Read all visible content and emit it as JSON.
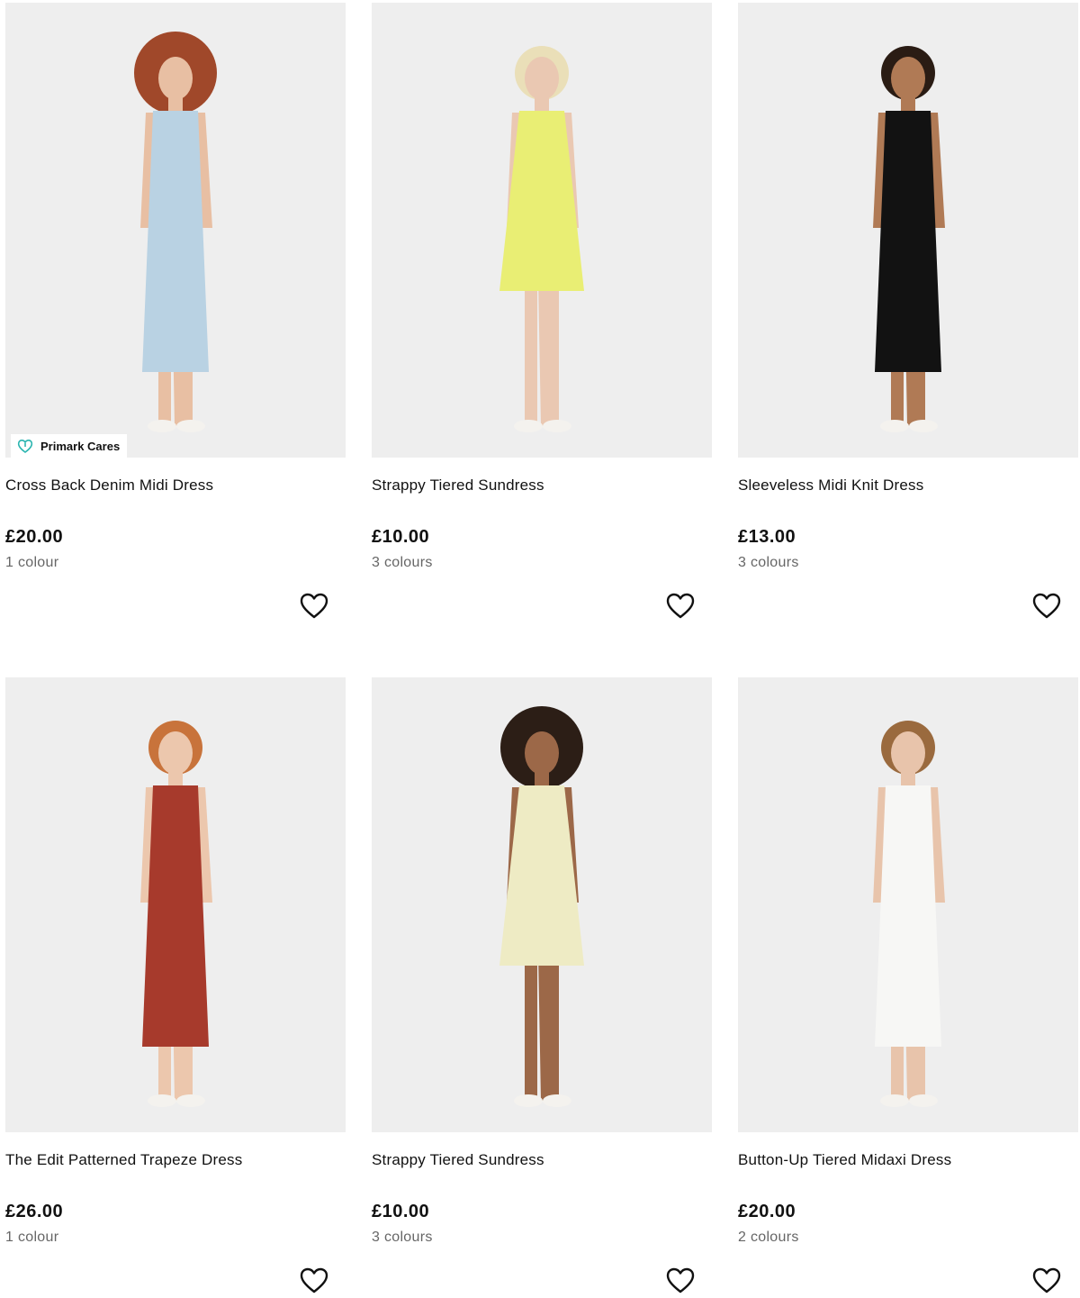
{
  "products": [
    {
      "name": "Cross Back Denim Midi Dress",
      "price": "£20.00",
      "colours": "1 colour",
      "badge": "Primark Cares",
      "dress_color": "#b9d2e3",
      "hair_color": "#a0482a",
      "skin_color": "#e8bfa3"
    },
    {
      "name": "Strappy Tiered Sundress",
      "price": "£10.00",
      "colours": "3 colours",
      "badge": "",
      "dress_color": "#e9ee74",
      "hair_color": "#eadfb8",
      "skin_color": "#eac8b2"
    },
    {
      "name": "Sleeveless Midi Knit Dress",
      "price": "£13.00",
      "colours": "3 colours",
      "badge": "",
      "dress_color": "#121212",
      "hair_color": "#2a1c14",
      "skin_color": "#b07a55"
    },
    {
      "name": "The Edit Patterned Trapeze Dress",
      "price": "£26.00",
      "colours": "1 colour",
      "badge": "",
      "dress_color": "#a73a2c",
      "hair_color": "#c8733b",
      "skin_color": "#ecc7ad"
    },
    {
      "name": "Strappy Tiered Sundress",
      "price": "£10.00",
      "colours": "3 colours",
      "badge": "",
      "dress_color": "#eeebc4",
      "hair_color": "#2c1e16",
      "skin_color": "#9c6848"
    },
    {
      "name": "Button-Up Tiered Midaxi Dress",
      "price": "£20.00",
      "colours": "2 colours",
      "badge": "",
      "dress_color": "#f7f7f5",
      "hair_color": "#9a6a3e",
      "skin_color": "#e8c4ab"
    }
  ],
  "icons": {
    "wishlist": "heart-outline-icon",
    "badge": "heart-badge-icon"
  },
  "colors": {
    "badge_accent": "#2bb5b0",
    "photo_bg": "#eeeeee"
  }
}
